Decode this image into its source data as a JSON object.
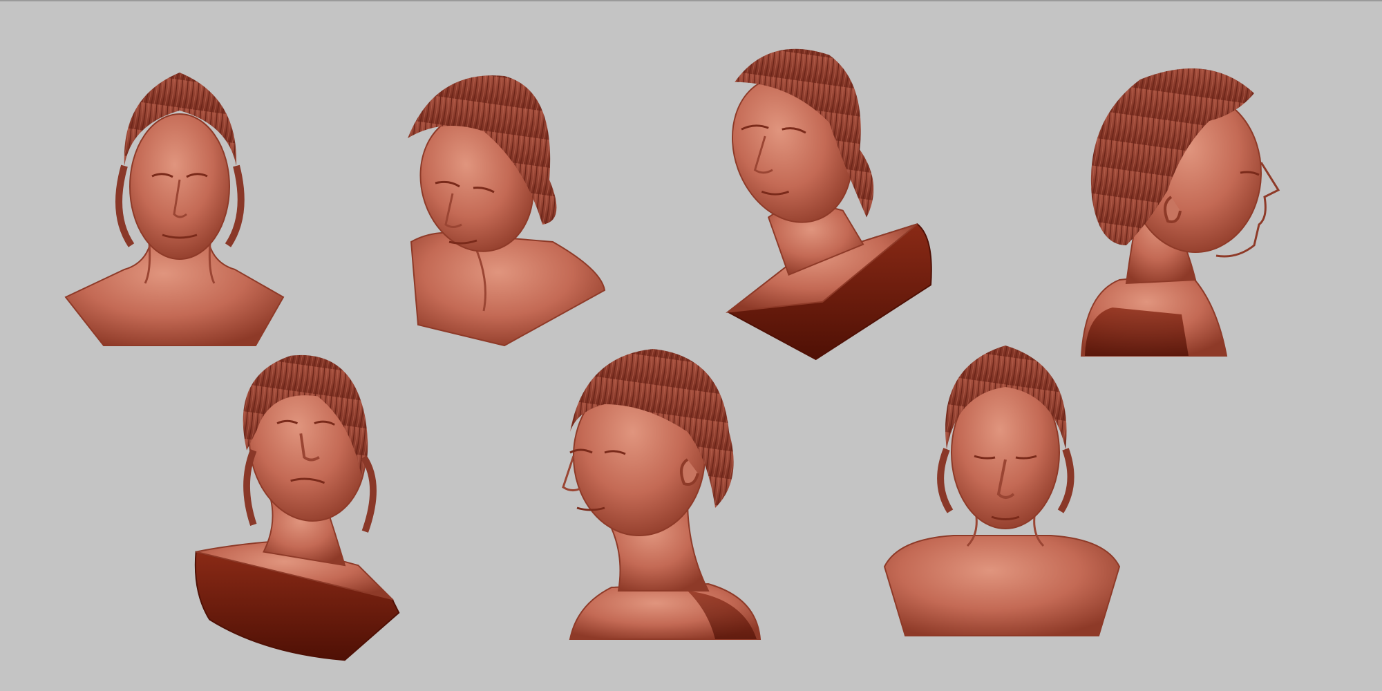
{
  "scene": {
    "background_color": "#c4c4c4",
    "clay_color": "#c46a55",
    "clay_light": "#d98a74",
    "clay_dark": "#7a2414",
    "hair_color": "#9a4535",
    "base_cut_color": "#6b1a0c"
  },
  "busts": [
    {
      "name": "bust-front-view",
      "view": "front"
    },
    {
      "name": "bust-three-quarter-down-view",
      "view": "three-quarter-down"
    },
    {
      "name": "bust-looking-up-left-view",
      "view": "looking-up-left"
    },
    {
      "name": "bust-right-profile-view",
      "view": "right-profile"
    },
    {
      "name": "bust-looking-up-underside-view",
      "view": "looking-up-underside"
    },
    {
      "name": "bust-left-three-quarter-view",
      "view": "left-three-quarter"
    },
    {
      "name": "bust-front-looking-down-view",
      "view": "front-down"
    }
  ]
}
